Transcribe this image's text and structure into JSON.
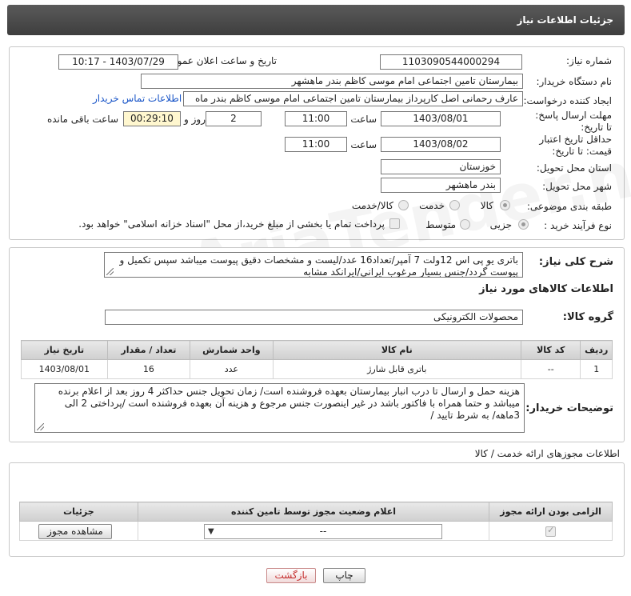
{
  "header": {
    "title": "جزئیات اطلاعات نیاز"
  },
  "form": {
    "need_number_label": "شماره نیاز:",
    "need_number": "1103090544000294",
    "announce_label": "تاریخ و ساعت اعلان عمومی:",
    "announce_value": "1403/07/29 - 10:17",
    "buyer_label": "نام دستگاه خریدار:",
    "buyer_value": "بیمارستان تامین اجتماعی امام موسی کاظم بندر ماهشهر",
    "creator_label": "ایجاد کننده درخواست:",
    "creator_value": "عارف رحمانی اصل کارپرداز بیمارستان تامین اجتماعی امام موسی کاظم بندر ماه",
    "contact_link": "اطلاعات تماس خریدار",
    "deadline_label": "مهلت ارسال پاسخ: تا تاریخ:",
    "deadline_date": "1403/08/01",
    "time_label": "ساعت",
    "deadline_time": "11:00",
    "days_value": "2",
    "days_label": "روز و",
    "remaining_value": "00:29:10",
    "remaining_label": "ساعت باقی مانده",
    "validity_label": "حداقل تاریخ اعتبار قیمت: تا تاریخ:",
    "validity_date": "1403/08/02",
    "validity_time": "11:00",
    "province_label": "استان محل تحویل:",
    "province_value": "خوزستان",
    "city_label": "شهر محل تحویل:",
    "city_value": "بندر ماهشهر",
    "category_label": "طبقه بندی موضوعی:",
    "category_options": [
      "کالا",
      "خدمت",
      "کالا/خدمت"
    ],
    "category_selected": "کالا",
    "process_label": "نوع فرآیند خرید :",
    "process_options": [
      "جزیی",
      "متوسط"
    ],
    "process_selected": "جزیی",
    "payment_text": "پرداخت تمام یا بخشی از مبلغ خرید،از محل \"اسناد خزانه اسلامی\" خواهد بود."
  },
  "summary": {
    "label": "شرح کلی نیاز:",
    "text": "باتری یو پی اس 12ولت 7 آمپر/تعداد16 عدد/لیست و مشخصات دقیق پیوست میباشد سپس تکمیل و پیوست گردد/جنس بسیار مرغوب ایرانی/ایرانکد مشابه"
  },
  "goods": {
    "section_title": "اطلاعات کالاهای مورد نیاز",
    "group_label": "گروه کالا:",
    "group_value": "محصولات الکترونیکی",
    "columns": [
      "ردیف",
      "کد کالا",
      "نام کالا",
      "واحد شمارش",
      "تعداد / مقدار",
      "تاریخ نیاز"
    ],
    "rows": [
      [
        "1",
        "--",
        "باتری قابل شارژ",
        "عدد",
        "16",
        "1403/08/01"
      ]
    ]
  },
  "buyer_notes": {
    "label": "توضیحات خریدار:",
    "text": "هزینه حمل و ارسال تا درب انبار بیمارستان بعهده فروشنده است/ زمان تحویل جنس حداکثر 4 روز بعد از اعلام برنده میباشد و حتما همراه با فاکتور باشد در غیر اینصورت جنس مرجوع و هزینه آن بعهده فروشنده است /پرداختی 2 الی 3ماهه/ به شرط تایید /"
  },
  "permits": {
    "title": "اطلاعات مجوزهای ارائه خدمت / کالا",
    "columns": [
      "الزامی بودن ارائه مجوز",
      "اعلام وضعیت مجوز توسط تامین کننده",
      "جزئیات"
    ],
    "select_value": "--",
    "view_button": "مشاهده مجوز"
  },
  "footer": {
    "print_button": "چاپ",
    "back_button": "بازگشت"
  },
  "watermark": "AriaTender.net"
}
